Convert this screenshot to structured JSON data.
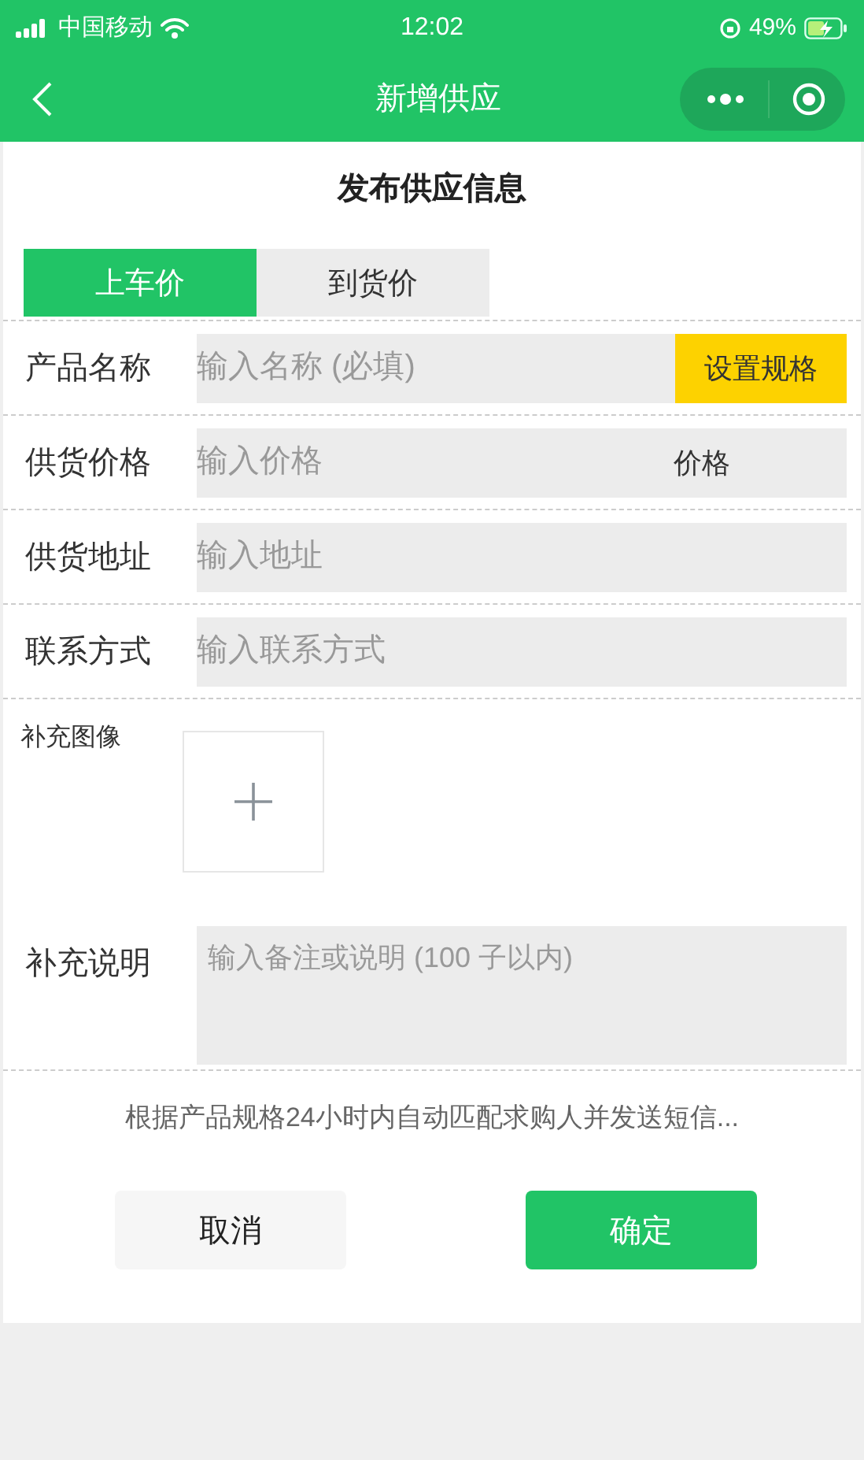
{
  "status_bar": {
    "carrier": "中国移动",
    "time": "12:02",
    "battery": "49%"
  },
  "nav": {
    "title": "新增供应"
  },
  "section_title": "发布供应信息",
  "tabs": [
    {
      "label": "上车价",
      "selected": true
    },
    {
      "label": "到货价",
      "selected": false
    }
  ],
  "fields": [
    {
      "kind": "input",
      "label": "产品名称",
      "placeholder": "输入名称 (必填)",
      "action": "设置规格"
    },
    {
      "kind": "input",
      "label": "供货价格",
      "placeholder": "输入价格",
      "suffix": "价格"
    },
    {
      "kind": "input",
      "label": "供货地址",
      "placeholder": "输入地址"
    },
    {
      "kind": "input",
      "label": "联系方式",
      "placeholder": "输入联系方式"
    },
    {
      "kind": "image",
      "label": "补充图像"
    },
    {
      "kind": "textarea",
      "label": "补充说明",
      "placeholder": "输入备注或说明 (100 子以内)"
    }
  ],
  "hint": "根据产品规格24小时内自动匹配求购人并发送短信...",
  "buttons": [
    {
      "kind": "secondary",
      "label": "取消"
    },
    {
      "kind": "primary",
      "label": "确定"
    }
  ]
}
